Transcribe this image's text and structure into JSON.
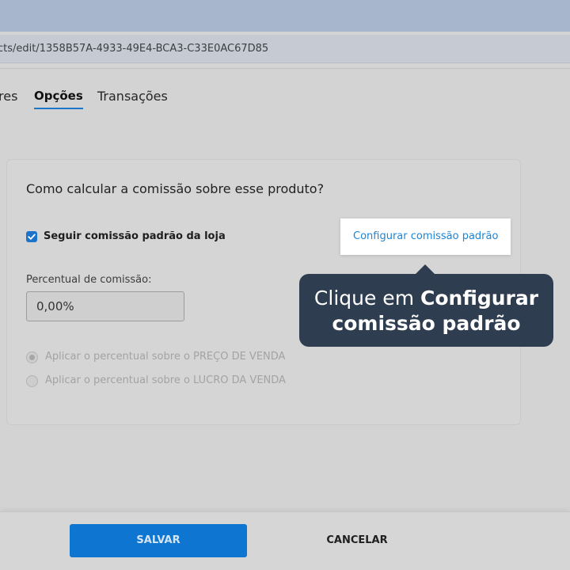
{
  "browser": {
    "url": "cts/edit/1358B57A-4933-49E4-BCA3-C33E0AC67D85"
  },
  "tabs": [
    {
      "label": "res",
      "active": false
    },
    {
      "label": "Opções",
      "active": true
    },
    {
      "label": "Transações",
      "active": false
    }
  ],
  "commission": {
    "question": "Como calcular a comissão sobre esse produto?",
    "checkbox_label": "Seguir comissão padrão da loja",
    "checkbox_checked": true,
    "config_link": "Configurar comissão padrão",
    "percent_label": "Percentual de comissão:",
    "percent_value": "0,00%",
    "radio_options": [
      {
        "label": "Aplicar o percentual sobre o PREÇO DE VENDA",
        "selected": true
      },
      {
        "label": "Aplicar o percentual sobre o LUCRO DA VENDA",
        "selected": false
      }
    ]
  },
  "tooltip": {
    "line1_prefix": "Clique em ",
    "line1_bold": "Configurar",
    "line2_bold": "comissão padrão"
  },
  "footer": {
    "save_label": "SALVAR",
    "cancel_label": "CANCELAR"
  },
  "colors": {
    "accent": "#1b74c9",
    "link": "#1b86d8",
    "tooltip_bg": "#2e3d4f",
    "save_button": "#0e76d0"
  },
  "icons": {
    "checkbox": "check-icon"
  }
}
